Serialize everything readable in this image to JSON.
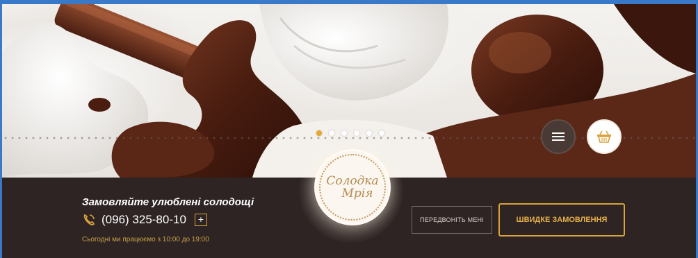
{
  "hero": {
    "slider_dots": [
      true,
      false,
      false,
      false,
      false,
      false
    ],
    "menu_icon": "hamburger-icon",
    "cart_icon": "basket-icon"
  },
  "logo": {
    "line1": "Солодка",
    "line2": "Мрія"
  },
  "contact": {
    "tagline": "Замовляйте улюблені солодощі",
    "phone": "(096) 325-80-10",
    "plus": "+",
    "hours": "Сьогодні ми працюємо з 10:00 до 19:00"
  },
  "buttons": {
    "callback": "ПЕРЕДВОНІТЬ МЕНІ",
    "quick_order": "ШВИДКЕ ЗАМОВЛЕННЯ"
  },
  "colors": {
    "bar_background": "#2d2423",
    "accent_gold": "#d9a23a",
    "frame_blue": "#3a79c8"
  }
}
